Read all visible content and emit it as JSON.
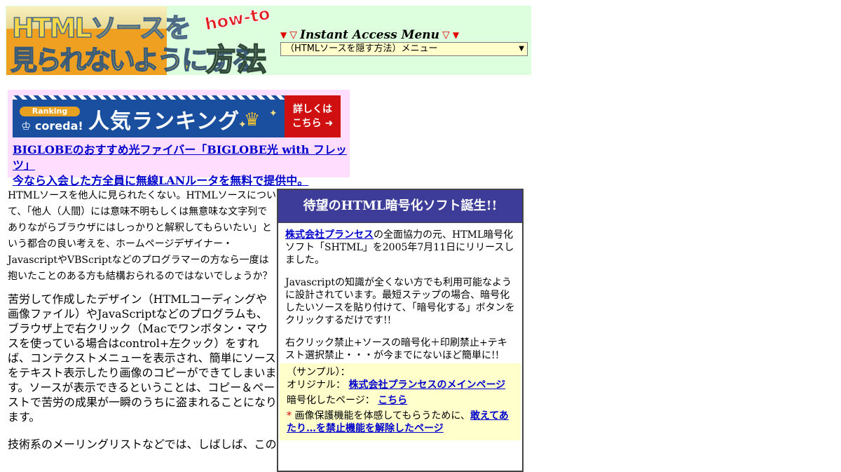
{
  "header": {
    "logo": {
      "line1": "HTMLソースを",
      "line2": "見られないようにする",
      "howto": "how-to",
      "houhou": "方法"
    },
    "instant_access": {
      "label": "Instant Access Menu",
      "selected": "（HTMLソースを隠す方法）メニュー"
    }
  },
  "ad": {
    "banner": {
      "ranking_badge": "Ranking",
      "brand": "coreda!",
      "title": "人気ランキング",
      "cta_line1": "詳しくは",
      "cta_line2": "こちら"
    },
    "link_line1": "BIGLOBEのおすすめ光ファイバー「BIGLOBE光 with フレッツ」",
    "link_line2": "今なら入会した方全員に無線LANルータを無料で提供中。"
  },
  "main": {
    "p1": "HTMLソースを他人に見られたくない。HTMLソースについて、「他人（人間）には意味不明もしくは無意味な文字列でありながらブラウザにはしっかりと解釈してもらいたい」という都合の良い考えを、ホームページデザイナー・JavascriptやVBScriptなどのプログラマーの方なら一度は抱いたことのある方も結構おられるのではないでしょうか？",
    "p2": "苦労して作成したデザイン（HTMLコーディングや画像ファイル）やJavaScriptなどのプログラムも、ブラウザ上で右クリック（Macでワンボタン・マウスを使っている場合はcontrol+左クック）をすれば、コンテクストメニューを表示され、簡単にソースをテキスト表示したり画像のコピーができてしまいます。ソースが表示できるということは、コピー＆ペーストで苦労の成果が一瞬のうちに盗まれることになります。",
    "p3": "技術系のメーリングリストなどでは、しばしば、この"
  },
  "promo": {
    "heading": "待望のHTML暗号化ソフト誕生!!",
    "company_link": "株式会社プランセス",
    "p1_rest": "の全面協力の元、HTML暗号化ソフト「SHTML」を2005年7月11日にリリースしました。",
    "p2": "Javascriptの知識が全くない方でも利用可能なように設計されています。最短ステップの場合、暗号化したいソースを貼り付けて、「暗号化する」ボタンをクリックするだけです!!",
    "p3": "右クリック禁止+ソースの暗号化＋印刷禁止+テキスト選択禁止・・・が今までにないほど簡単に!!",
    "sample": {
      "label": "（サンプル）：",
      "original_label": "オリジナル：",
      "original_link": "株式会社プランセスのメインページ",
      "encrypted_label": "暗号化したページ：",
      "encrypted_link": "こちら",
      "note_mark": "*",
      "note_text": "画像保護機能を体感してもらうために、",
      "note_link": "敢えてあたり…を禁止機能を解除したページ"
    }
  }
}
